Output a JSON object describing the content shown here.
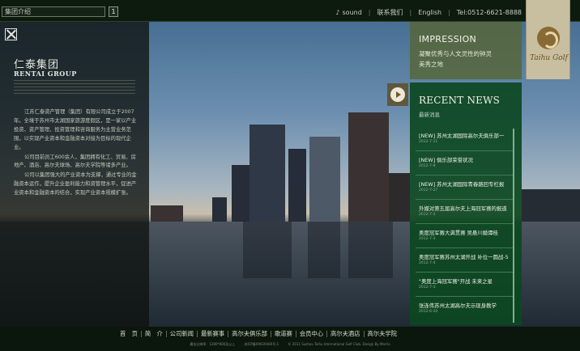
{
  "header": {
    "breadcrumb": "集团介绍",
    "breadcrumb_button": "1",
    "links": [
      "sound",
      "联系我们",
      "English",
      "Tel:0512-6621-8888"
    ]
  },
  "logo": {
    "brand": "Taihu Golf"
  },
  "intro": {
    "title": "仁泰集团",
    "subtitle": "RENTAI GROUP",
    "paragraphs": [
      "江苏仁泰资产管理（集团）有限公司成立于2007年。全境于苏州市太湖国家旅游度假区，是一家以产业投资、资产管理、投资管理和咨询服务为主营业务范围，以实现产业资本和金融资本对接为目标的现代企业。",
      "公司目前员工600余人，集团拥有化工、贸易、房地产、酒店、高尔夫球场、高尔夫学院等诸多产业。",
      "公司以集团强大的产业资本为支撑，通过专业的金融资本运作，提升企业盈利能力和资管理水平，促进产业资本和金融资本的结合，实现产业资本规模扩张。"
    ]
  },
  "impression": {
    "title": "IMPRESSION",
    "line1": "凝聚优秀与人文灵性的钟灵",
    "line2": "美秀之地"
  },
  "news": {
    "title": "RECENT NEWS",
    "subtitle": "最新消息",
    "items": [
      {
        "title": "[NEW] 苏州太湖国际高尔夫俱乐部一",
        "date": "2012-7-11"
      },
      {
        "title": "[NEW] 俱乐部荣誉状况",
        "date": "2012-7-8"
      },
      {
        "title": "[NEW] 苏州太湖国际青春路回专栏报",
        "date": "2012-7-27"
      },
      {
        "title": "外媒对第五届高尔夫上海冠军赛的报道",
        "date": "2012-7-3"
      },
      {
        "title": "奥度冠军赛大满贯赛 吴悬川婚谭桂",
        "date": "2012-7-3"
      },
      {
        "title": "奥度冠军赛苏州太湖开战 补位一圆战-5",
        "date": "2012-7-4"
      },
      {
        "title": "\"奥度上海冠军赛\"开战 未来之星",
        "date": "2012-7-3"
      },
      {
        "title": "张连伟苏州太湖高尔夫示现身教学",
        "date": "2012-6-20"
      }
    ]
  },
  "footer": {
    "nav": [
      "首　页",
      "简　介",
      "公司新闻",
      "最新赛事",
      "高尔夫俱乐部",
      "歌道赛",
      "会员中心",
      "高尔夫酒店",
      "高尔夫学院"
    ],
    "line": [
      "最佳分辨率：1280*800及以上",
      "苏ICP备09029469号-1",
      "© 2011 Suzhou Taihu International Golf Club. Design By Marrio"
    ]
  }
}
